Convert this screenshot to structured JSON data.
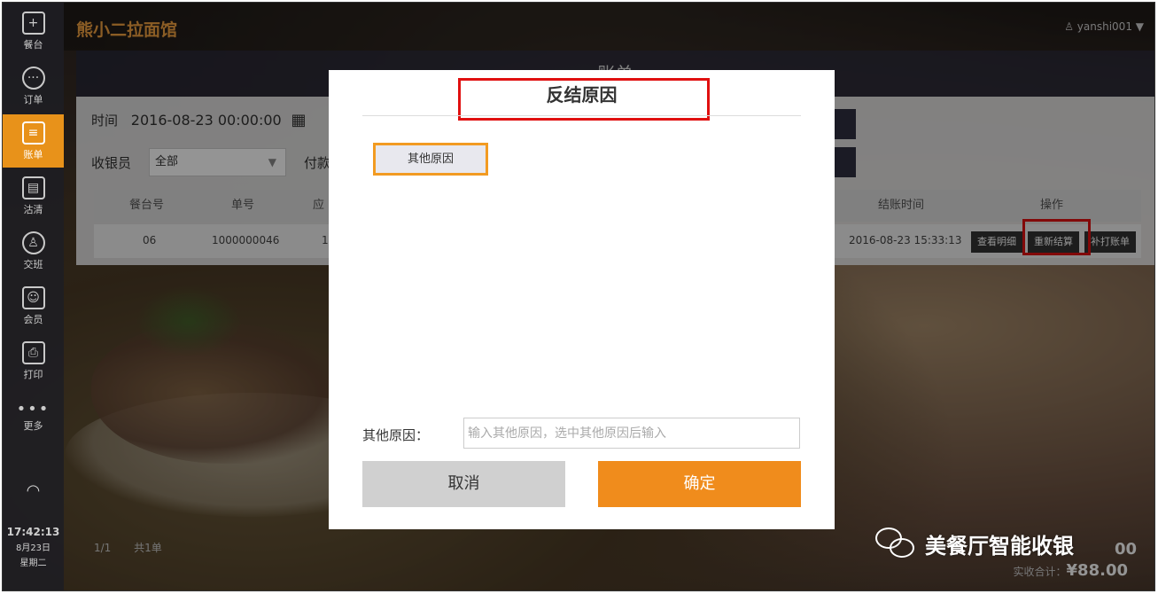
{
  "app": {
    "shop_name": "熊小二拉面馆",
    "user": "yanshi001",
    "page_title": "账单"
  },
  "sidebar": {
    "items": [
      {
        "label": "餐台",
        "icon": "plus-icon"
      },
      {
        "label": "订单",
        "icon": "chat-icon"
      },
      {
        "label": "账单",
        "icon": "bill-icon"
      },
      {
        "label": "沽清",
        "icon": "document-icon"
      },
      {
        "label": "交班",
        "icon": "person-icon"
      },
      {
        "label": "会员",
        "icon": "member-card-icon"
      },
      {
        "label": "打印",
        "icon": "printer-icon"
      },
      {
        "label": "更多",
        "icon": "more-icon"
      }
    ],
    "time": "17:42:13",
    "date": "8月23日",
    "weekday": "星期二"
  },
  "filters": {
    "time_label": "时间",
    "time_value": "2016-08-23 00:00:00",
    "cashier_label": "收银员",
    "cashier_value": "全部",
    "pay_label": "付款"
  },
  "table": {
    "headers": [
      "餐台号",
      "单号",
      "应",
      "结账时间",
      "操作"
    ],
    "row": {
      "table_no": "06",
      "order_no": "1000000046",
      "amount_partial": "1",
      "checkout_time": "2016-08-23 15:33:13",
      "btn_detail": "查看明细",
      "btn_resettle": "重新结算",
      "btn_reprint": "补打账单"
    }
  },
  "pager": {
    "page": "1/1",
    "count": "共1单"
  },
  "totals": {
    "label": "实收合计：",
    "value": "¥88.00",
    "value_partial": "00"
  },
  "modal": {
    "title": "反结原因",
    "reason_option": "其他原因",
    "other_label": "其他原因：",
    "other_placeholder": "输入其他原因，选中其他原因后输入",
    "cancel_label": "取消",
    "confirm_label": "确定"
  },
  "watermark": "美餐厅智能收银",
  "colors": {
    "accent": "#f08c1c",
    "highlight_box": "#e01010",
    "sidebar_bg": "#1e1e23"
  }
}
